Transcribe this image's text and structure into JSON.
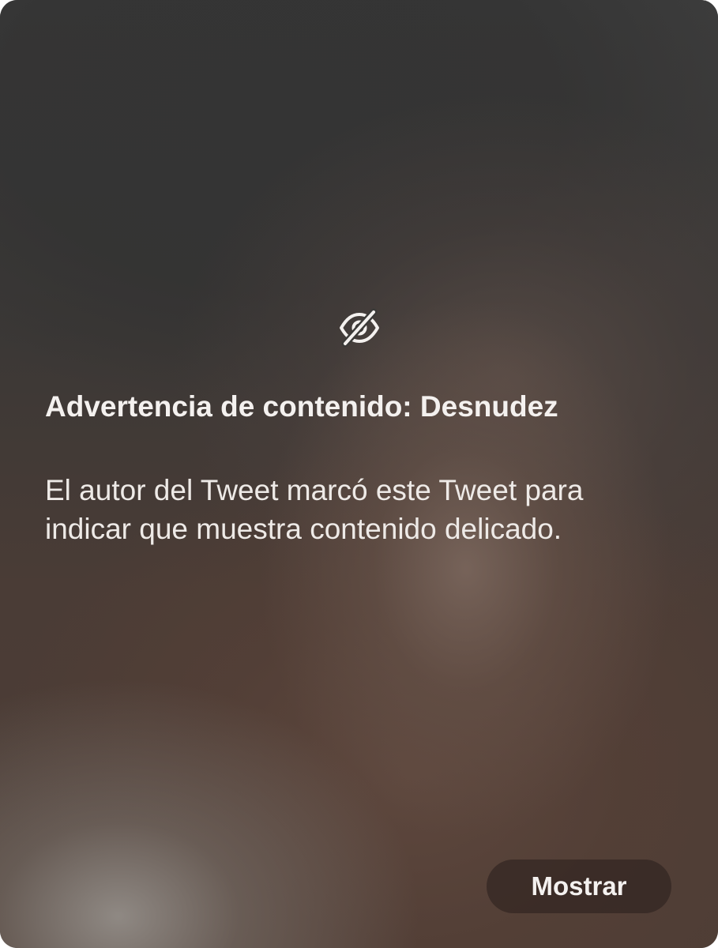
{
  "warning": {
    "icon": "eye-slash-icon",
    "title": "Advertencia de contenido: Desnudez",
    "description_lines": [
      "El autor del Tweet marcó este Tweet para",
      "indicar que muestra contenido delicado."
    ],
    "show_label": "Mostrar"
  },
  "colors": {
    "text": "#f4f1ef",
    "button_bg": "#281e1b"
  }
}
